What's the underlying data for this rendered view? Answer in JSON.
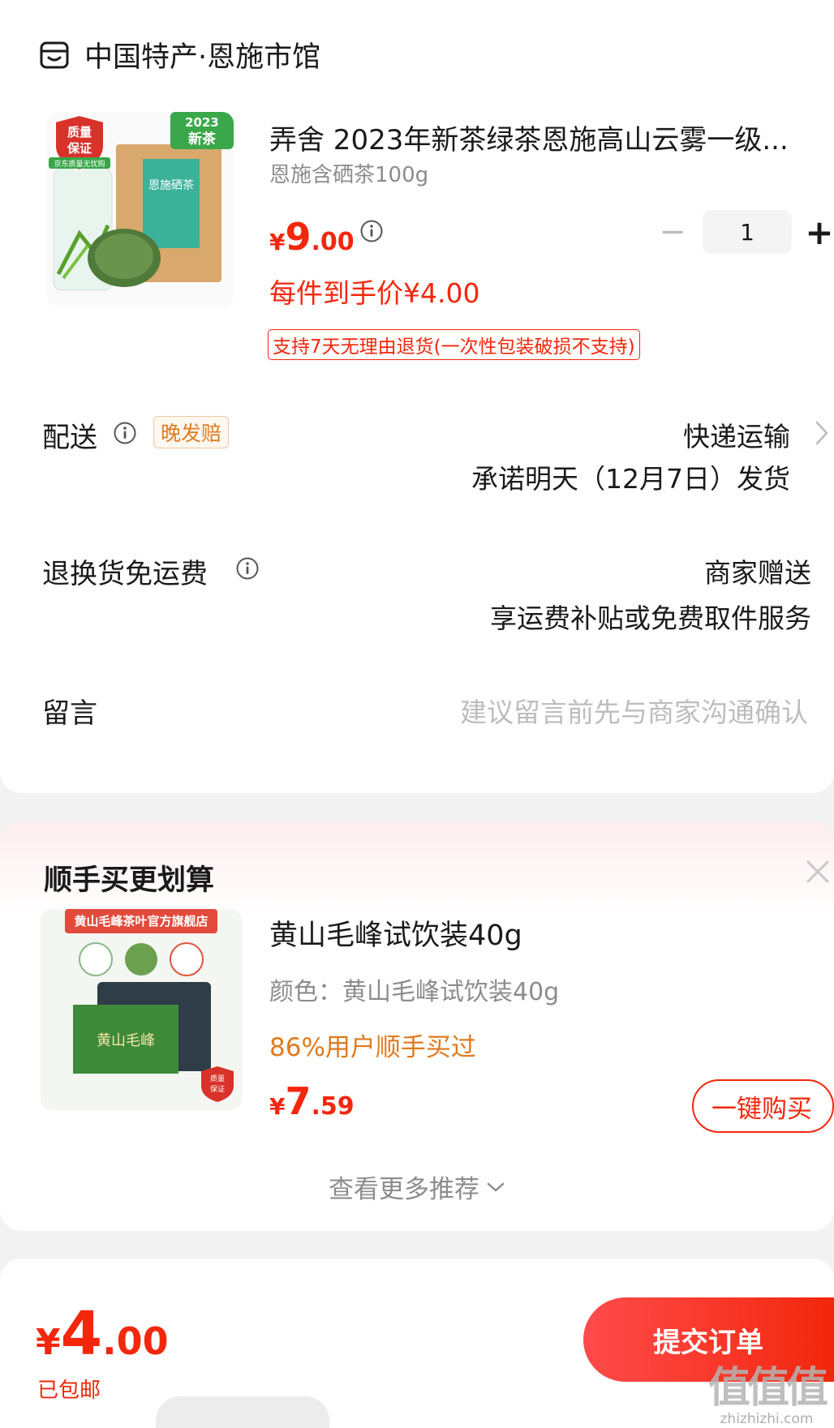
{
  "store": {
    "name": "中国特产·恩施市馆"
  },
  "product": {
    "title": "弄舍 2023年新茶绿茶恩施高山云雾一级...",
    "spec": "恩施含硒茶100g",
    "price_symbol": "¥",
    "price_int": "9",
    "price_dec": ".00",
    "quantity": "1",
    "qty_minus": "−",
    "qty_plus": "+",
    "net_price": "每件到手价¥4.00",
    "return_policy": "支持7天无理由退货(一次性包装破损不支持)",
    "image": {
      "badge_line1": "质量",
      "badge_line2": "保证",
      "ribbon": "京东质量无忧购",
      "corner_year": "2023",
      "corner_label": "新茶",
      "pack_label": "恩施硒茶"
    }
  },
  "delivery": {
    "label": "配送",
    "tag": "晚发赔",
    "method": "快递运输",
    "promise": "承诺明天（12月7日）发货"
  },
  "return_shipping": {
    "label": "退换货免运费",
    "value": "商家赠送",
    "detail": "享运费补贴或免费取件服务"
  },
  "message": {
    "label": "留言",
    "placeholder": "建议留言前先与商家沟通确认"
  },
  "upsell": {
    "title": "顺手买更划算",
    "item": {
      "name": "黄山毛峰试饮装40g",
      "spec": "颜色：黄山毛峰试饮装40g",
      "stat": "86%用户顺手买过",
      "price_symbol": "¥",
      "price_int": "7",
      "price_dec": ".59",
      "buy_label": "一键购买",
      "image": {
        "store_banner": "黄山毛峰茶叶官方旗舰店",
        "box_label": "黄山毛峰",
        "badge_line1": "质量",
        "badge_line2": "保证"
      }
    },
    "more_label": "查看更多推荐"
  },
  "footer": {
    "total_symbol": "¥",
    "total_int": "4",
    "total_dec": ".00",
    "shipping_note": "已包邮",
    "submit_label": "提交订单",
    "watermark_mark": "值值值",
    "watermark_text": "zhizhizhi.com"
  },
  "colors": {
    "accent": "#f2270c",
    "orange": "#e07a1e",
    "muted": "#8c8c8c"
  }
}
